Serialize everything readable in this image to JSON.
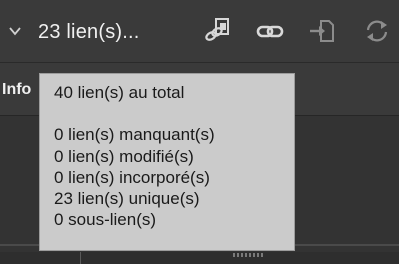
{
  "header": {
    "title": "23 lien(s)...",
    "toolbar": {
      "relink_icon": "relink-icon",
      "goto_link_icon": "chain-link-icon",
      "edit_original_icon": "edit-original-icon",
      "update_link_icon": "refresh-icon"
    }
  },
  "info": {
    "label": "Info"
  },
  "tooltip": {
    "total": "40 lien(s) au total",
    "lines": [
      "0 lien(s) manquant(s)",
      "0 lien(s) modifié(s)",
      "0 lien(s) incorporé(s)",
      "23 lien(s) unique(s)",
      "0 sous-lien(s)"
    ]
  },
  "colors": {
    "panel_bg": "#3a3a3a",
    "tooltip_bg": "#cbcbcb",
    "text_light": "#f0f0f0",
    "text_dark": "#1a1a1a"
  }
}
